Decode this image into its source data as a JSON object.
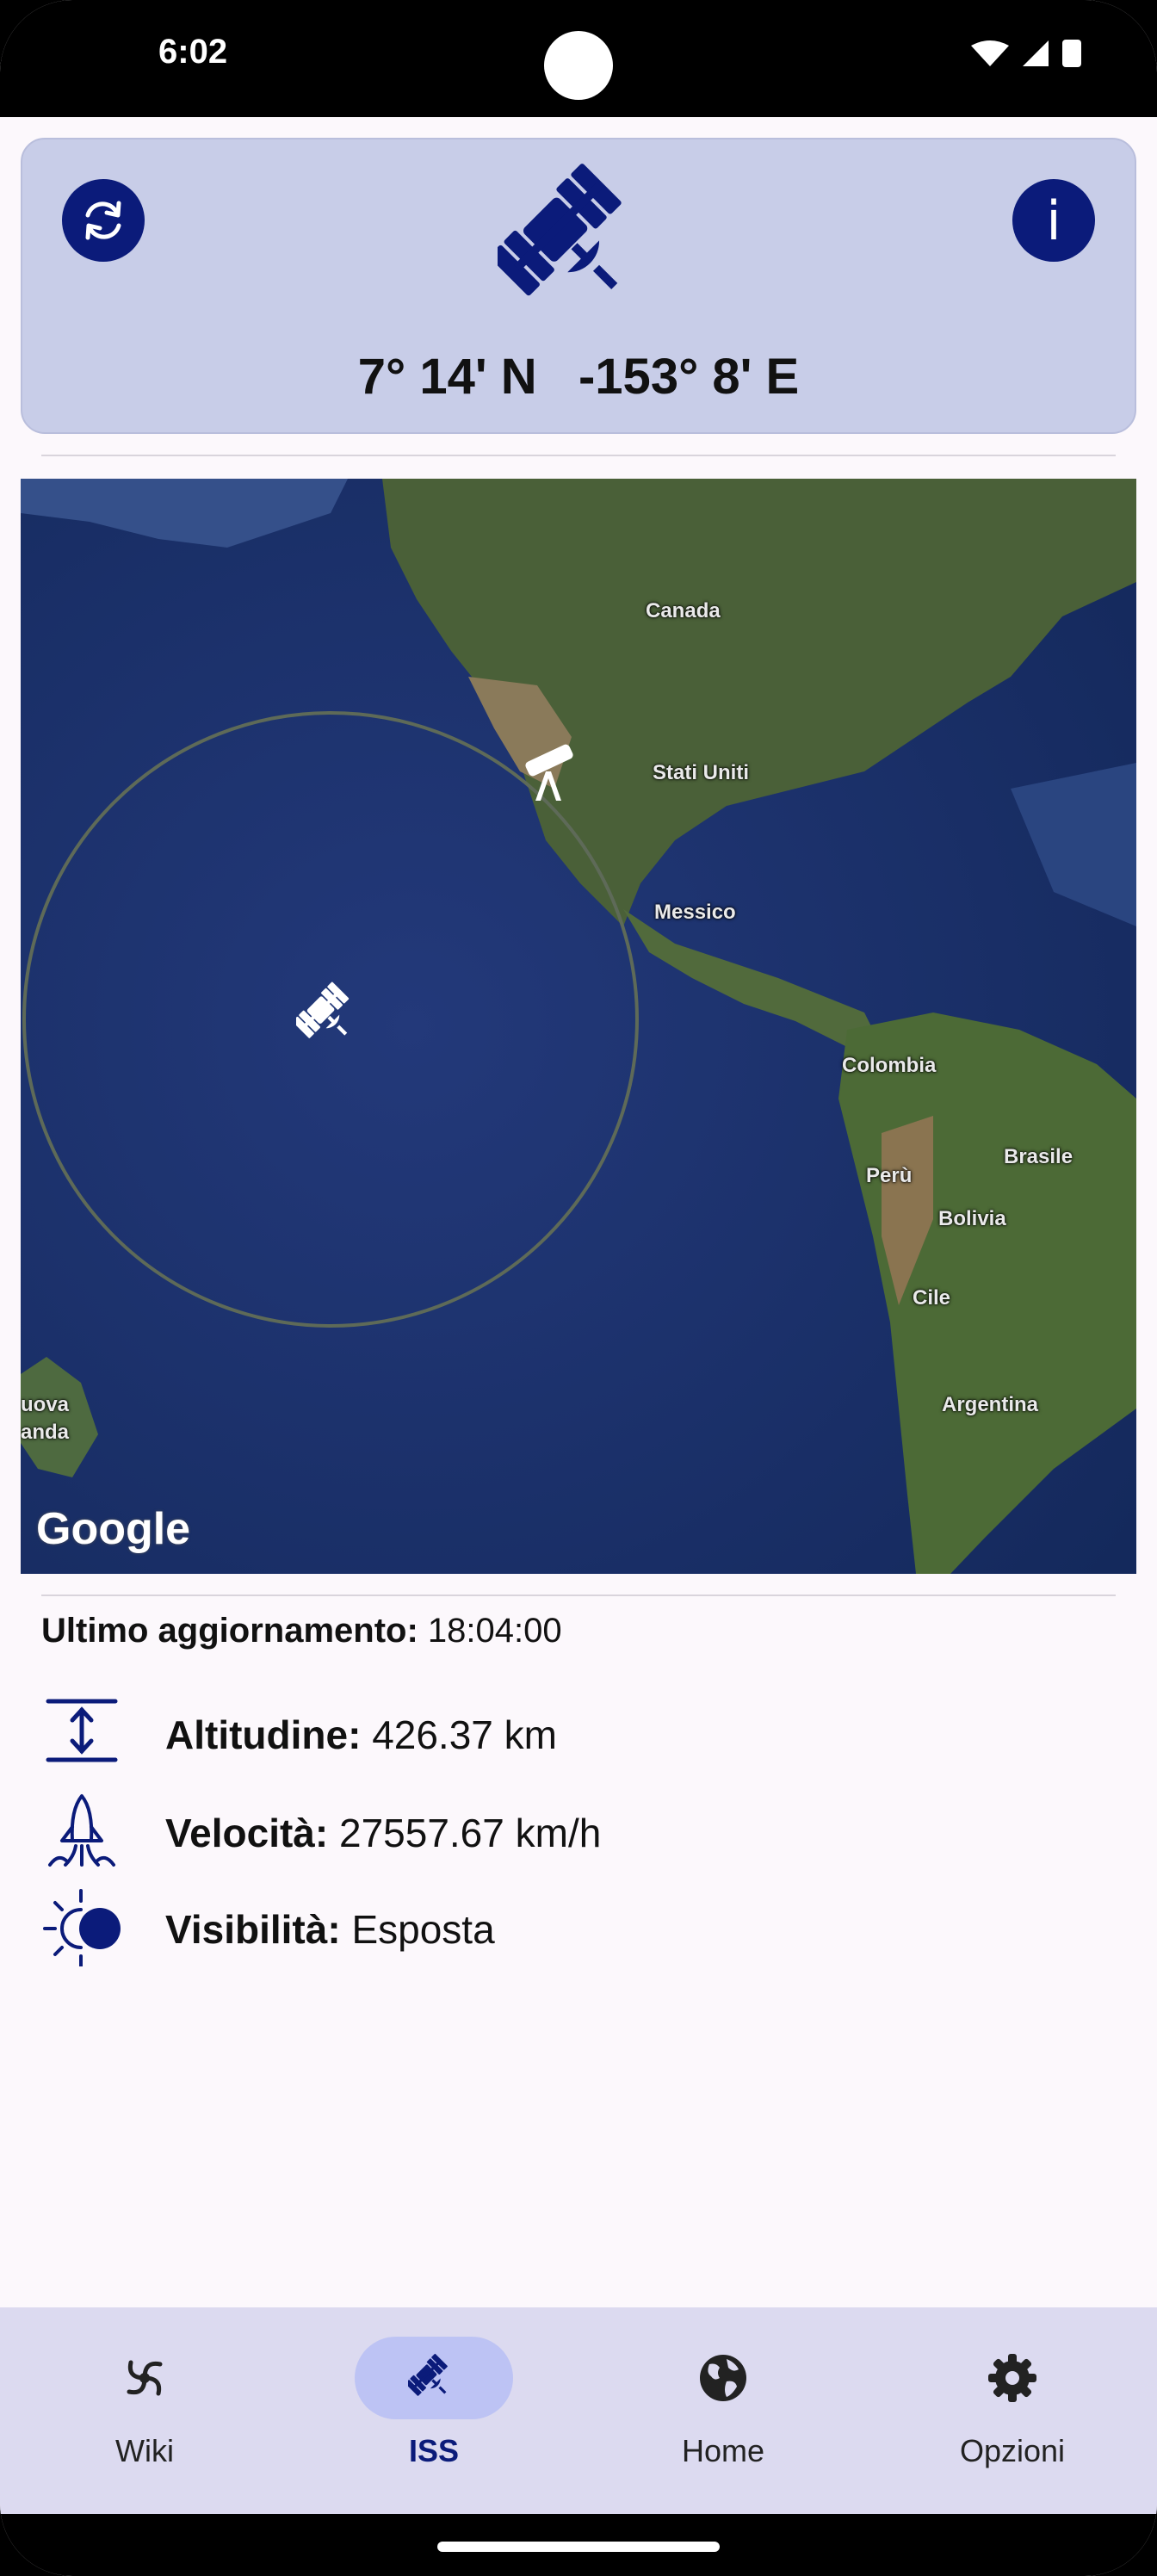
{
  "status_bar": {
    "time": "6:02"
  },
  "header": {
    "latitude": "7° 14' N",
    "longitude": "-153° 8' E",
    "refresh_icon": "refresh-icon",
    "info_icon": "info-icon",
    "info_glyph": "i"
  },
  "map": {
    "labels": {
      "canada": "Canada",
      "usa": "Stati Uniti",
      "mexico": "Messico",
      "colombia": "Colombia",
      "brazil": "Brasile",
      "peru": "Perù",
      "bolivia": "Bolivia",
      "chile": "Cile",
      "argentina": "Argentina",
      "nz1": "uova",
      "nz2": "anda"
    },
    "attribution": "Google"
  },
  "info": {
    "last_update_label": "Ultimo aggiornamento:",
    "last_update_value": "18:04:00",
    "altitude_label": "Altitudine:",
    "altitude_value": "426.37 km",
    "velocity_label": "Velocità:",
    "velocity_value": "27557.67 km/h",
    "visibility_label": "Visibilità:",
    "visibility_value": "Esposta"
  },
  "nav": {
    "items": [
      {
        "label": "Wiki",
        "icon": "galaxy-icon",
        "active": false
      },
      {
        "label": "ISS",
        "icon": "satellite-icon",
        "active": true
      },
      {
        "label": "Home",
        "icon": "globe-icon",
        "active": false
      },
      {
        "label": "Opzioni",
        "icon": "gear-icon",
        "active": false
      }
    ]
  },
  "colors": {
    "primary": "#0b1b7a",
    "header_bg": "#c8cde8",
    "nav_bg": "#dcdaf0",
    "nav_active_pill": "#bdc3f4",
    "page_bg": "#fcf8fc"
  }
}
